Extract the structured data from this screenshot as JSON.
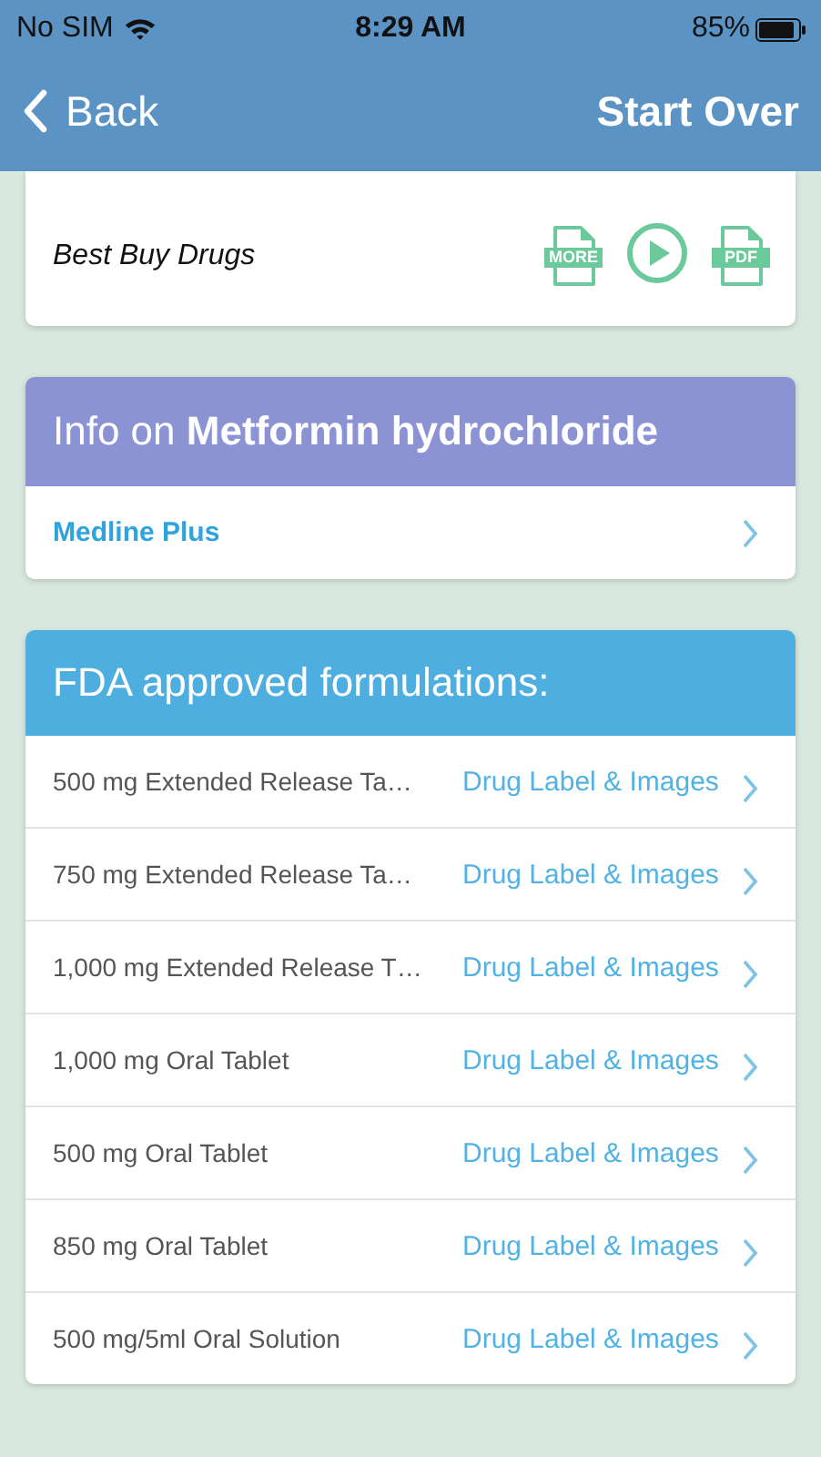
{
  "status_bar": {
    "carrier": "No SIM",
    "time": "8:29 AM",
    "battery": "85%"
  },
  "nav": {
    "back": "Back",
    "action": "Start Over"
  },
  "source_card": {
    "title": "Best Buy Drugs",
    "actions": [
      {
        "kind": "doc",
        "label": "MORE"
      },
      {
        "kind": "play"
      },
      {
        "kind": "doc",
        "label": "PDF"
      }
    ]
  },
  "info_card": {
    "title": "Info on **Metformin hydrochloride**",
    "links": [
      "Medline Plus"
    ]
  },
  "formulations": {
    "title": "FDA approved formulations:",
    "rows": [
      {
        "name": "500 mg Extended Release Ta…",
        "link": "Drug Label & Images"
      },
      {
        "name": "750 mg Extended Release Ta…",
        "link": "Drug Label & Images"
      },
      {
        "name": "1,000 mg Extended Release T…",
        "link": "Drug Label & Images"
      },
      {
        "name": "1,000 mg Oral Tablet",
        "link": "Drug Label & Images"
      },
      {
        "name": "500 mg Oral Tablet",
        "link": "Drug Label & Images"
      },
      {
        "name": "850 mg Oral Tablet",
        "link": "Drug Label & Images"
      },
      {
        "name": "500 mg/5ml Oral Solution",
        "link": "Drug Label & Images"
      }
    ]
  }
}
